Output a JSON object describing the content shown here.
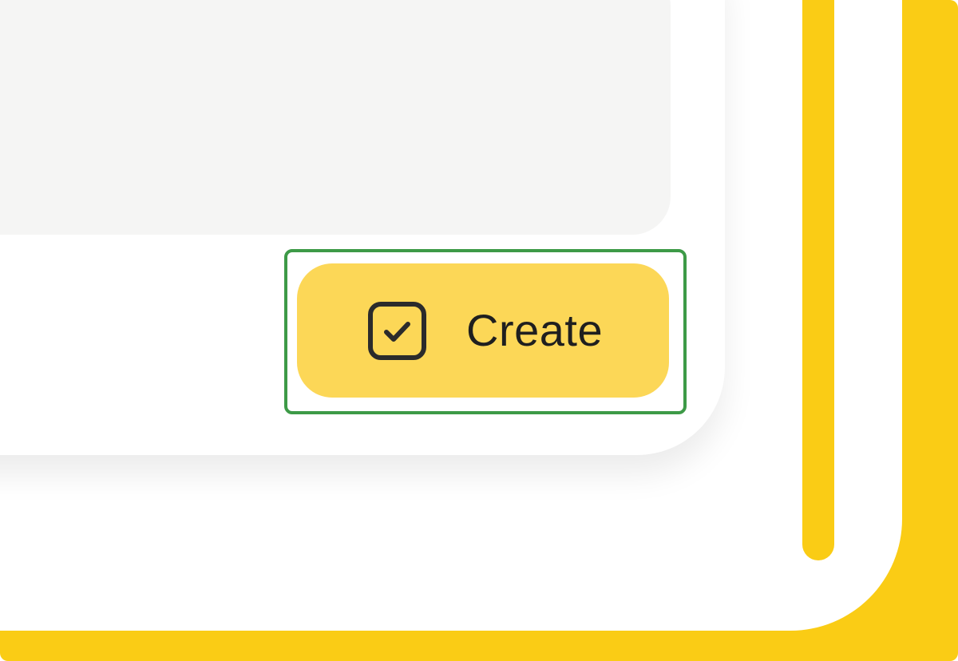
{
  "dialog": {
    "create_button_label": "Create",
    "create_button_icon": "checkbox-check-icon"
  },
  "colors": {
    "accent_yellow": "#facc15",
    "button_yellow": "#fcd757",
    "highlight_green": "#3d9a47",
    "input_background": "#f5f5f4"
  }
}
